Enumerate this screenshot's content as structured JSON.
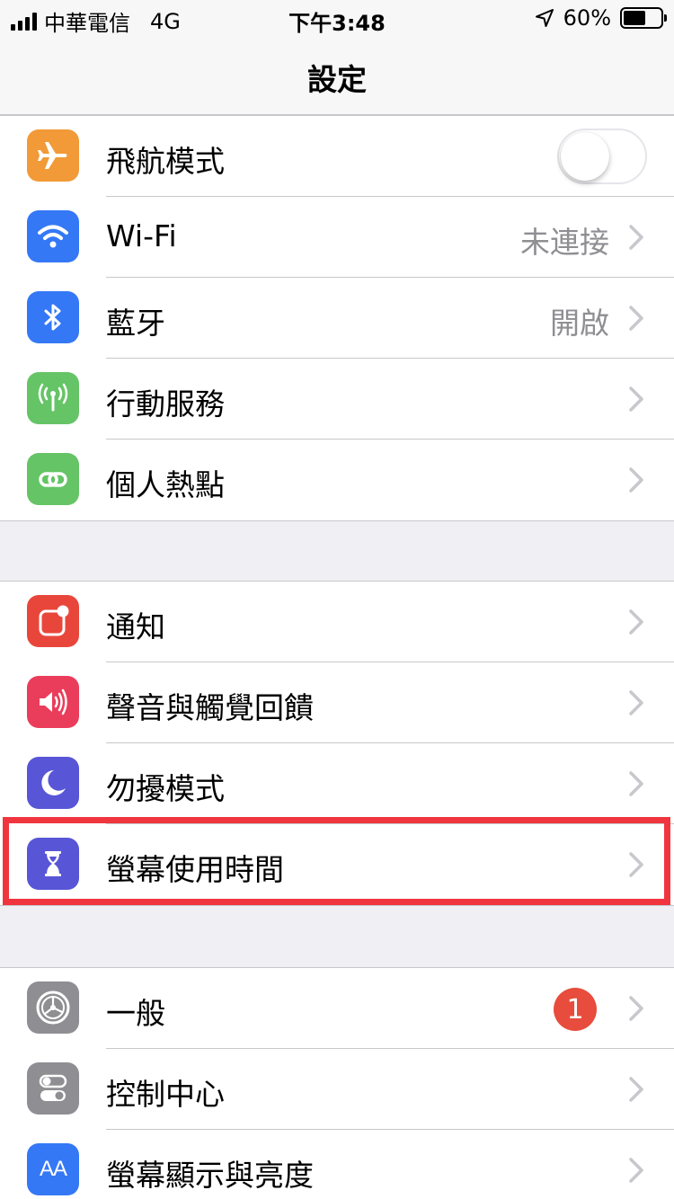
{
  "status_bar": {
    "carrier": "中華電信",
    "network": "4G",
    "time": "下午3:48",
    "battery_percent": "60%",
    "battery_level": 0.6
  },
  "nav": {
    "title": "設定"
  },
  "groups": [
    {
      "rows": [
        {
          "label": "飛航模式",
          "icon": "airplane-icon",
          "color": "#f19a37",
          "toggle": false
        },
        {
          "label": "Wi-Fi",
          "icon": "wifi-icon",
          "color": "#3478f6",
          "value": "未連接"
        },
        {
          "label": "藍牙",
          "icon": "bluetooth-icon",
          "color": "#3478f6",
          "value": "開啟"
        },
        {
          "label": "行動服務",
          "icon": "antenna-icon",
          "color": "#65c466"
        },
        {
          "label": "個人熱點",
          "icon": "hotspot-icon",
          "color": "#65c466"
        }
      ]
    },
    {
      "rows": [
        {
          "label": "通知",
          "icon": "notifications-icon",
          "color": "#e9463b"
        },
        {
          "label": "聲音與觸覺回饋",
          "icon": "speaker-icon",
          "color": "#ea3d5b"
        },
        {
          "label": "勿擾模式",
          "icon": "moon-icon",
          "color": "#5856d6"
        },
        {
          "label": "螢幕使用時間",
          "icon": "hourglass-icon",
          "color": "#5856d6",
          "highlighted": true
        }
      ]
    },
    {
      "rows": [
        {
          "label": "一般",
          "icon": "gear-icon",
          "color": "#8e8e93",
          "badge": "1"
        },
        {
          "label": "控制中心",
          "icon": "switches-icon",
          "color": "#8e8e93"
        },
        {
          "label": "螢幕顯示與亮度",
          "icon": "text-size-icon",
          "color": "#3478f6",
          "icon_text": "AA"
        }
      ]
    }
  ],
  "colors": {
    "highlight": "#f0353f",
    "badge": "#e74c3c",
    "separator": "#c8c7cc"
  }
}
